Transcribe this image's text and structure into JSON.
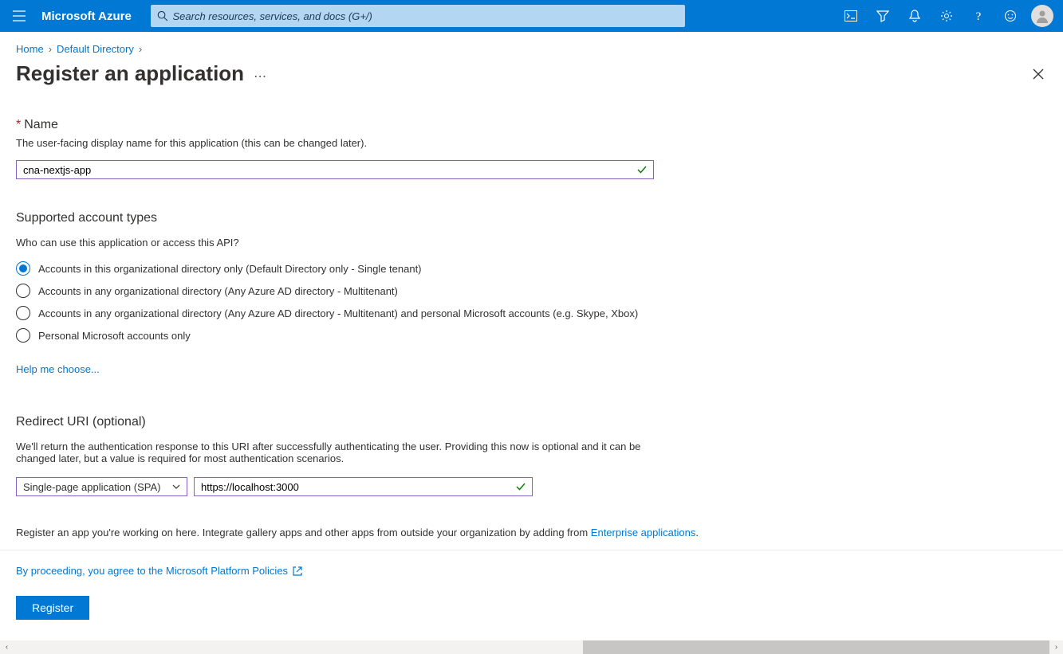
{
  "topbar": {
    "brand": "Microsoft Azure",
    "search_placeholder": "Search resources, services, and docs (G+/)"
  },
  "breadcrumb": {
    "items": [
      "Home",
      "Default Directory"
    ]
  },
  "page": {
    "title": "Register an application"
  },
  "name_field": {
    "label": "Name",
    "desc": "The user-facing display name for this application (this can be changed later).",
    "value": "cna-nextjs-app"
  },
  "account_types": {
    "title": "Supported account types",
    "desc": "Who can use this application or access this API?",
    "options": [
      "Accounts in this organizational directory only (Default Directory only - Single tenant)",
      "Accounts in any organizational directory (Any Azure AD directory - Multitenant)",
      "Accounts in any organizational directory (Any Azure AD directory - Multitenant) and personal Microsoft accounts (e.g. Skype, Xbox)",
      "Personal Microsoft accounts only"
    ],
    "help_link": "Help me choose..."
  },
  "redirect": {
    "title": "Redirect URI (optional)",
    "desc": "We'll return the authentication response to this URI after successfully authenticating the user. Providing this now is optional and it can be changed later, but a value is required for most authentication scenarios.",
    "platform": "Single-page application (SPA)",
    "uri": "https://localhost:3000"
  },
  "footer": {
    "note_prefix": "Register an app you're working on here. Integrate gallery apps and other apps from outside your organization by adding from ",
    "note_link": "Enterprise applications",
    "note_suffix": ".",
    "agree": "By proceeding, you agree to the Microsoft Platform Policies",
    "register": "Register"
  }
}
